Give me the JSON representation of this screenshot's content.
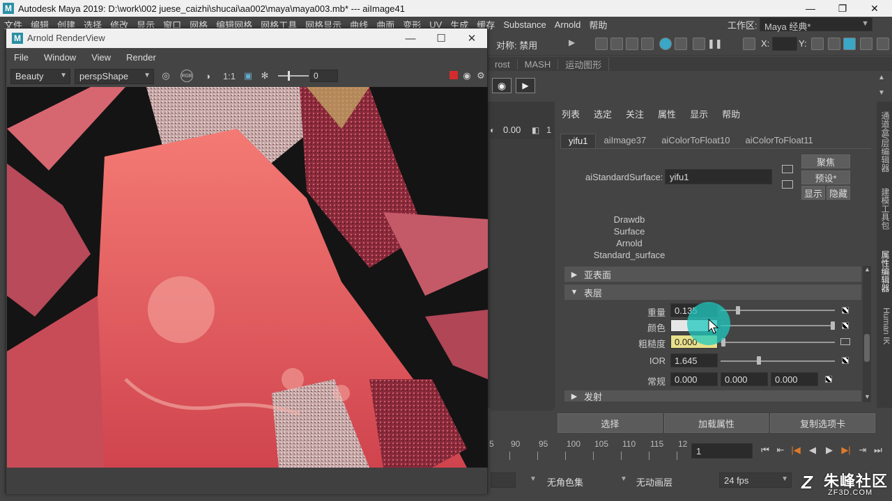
{
  "maya": {
    "title": "Autodesk Maya 2019: D:\\work\\002 juese_caizhi\\shucai\\aa002\\maya\\maya003.mb*   ---   aiImage41",
    "menus": [
      "文件",
      "编辑",
      "创建",
      "选择",
      "修改",
      "显示",
      "窗口",
      "网格",
      "编辑网格",
      "网格工具",
      "网格显示",
      "曲线",
      "曲面",
      "变形",
      "UV",
      "生成",
      "缓存",
      "Substance",
      "Arnold",
      "帮助"
    ],
    "workspace_label": "工作区:",
    "workspace_value": "Maya 经典*",
    "symmetry_label": "对称: 禁用",
    "x_label": "X:",
    "y_label": "Y:",
    "shelf_tabs": [
      "rost",
      "MASH",
      "运动图形"
    ]
  },
  "arv": {
    "title": "Arnold RenderView",
    "menus": [
      "File",
      "Window",
      "View",
      "Render"
    ],
    "aov": "Beauty",
    "camera": "perspShape",
    "ratio": "1:1",
    "rgb_label": "RGB",
    "exposure": "0"
  },
  "timeline": {
    "frame_value": "0.00"
  },
  "attr_editor": {
    "menus": [
      "列表",
      "选定",
      "关注",
      "属性",
      "显示",
      "帮助"
    ],
    "tabs": [
      "yifu1",
      "aiImage37",
      "aiColorToFloat10",
      "aiColorToFloat11"
    ],
    "shader_type_label": "aiStandardSurface:",
    "shader_name": "yifu1",
    "focus_button": "聚焦",
    "presets_button": "预设*",
    "show_button": "显示",
    "hide_button": "隐藏",
    "description": [
      "Drawdb",
      "Surface",
      "Arnold",
      "Standard_surface"
    ],
    "sections": {
      "subsurface": "亚表面",
      "coat": "表层",
      "emission": "发射"
    },
    "coat": {
      "weight_label": "重量",
      "weight_value": "0.135",
      "weight_level": 0.135,
      "color_label": "颜色",
      "color_swatch": "#e6e6e6",
      "roughness_label": "粗糙度",
      "roughness_value": "0.000",
      "ior_label": "IOR",
      "ior_value": "1.645",
      "normal_label": "常规",
      "normal_values": [
        "0.000",
        "0.000",
        "0.000"
      ]
    },
    "bottom_buttons": [
      "选择",
      "加载属性",
      "复制选项卡"
    ]
  },
  "side_tabs": [
    "通道盒/层编辑器",
    "建模工具包",
    "属性编辑器",
    "Human IK"
  ],
  "timeslider": {
    "ticks": [
      "5",
      "90",
      "95",
      "100",
      "105",
      "110",
      "115",
      "12"
    ],
    "current_frame": "1"
  },
  "range_bar": {
    "char_set": "无角色集",
    "anim_layer": "无动画层",
    "fps": "24 fps"
  },
  "watermark": {
    "text": "朱峰社区",
    "url": "ZF3D.COM"
  },
  "colors": {
    "accent_cursor": "#1ec8be",
    "roughness_field": "#e8e08a",
    "stop_button": "#d62b2b"
  }
}
